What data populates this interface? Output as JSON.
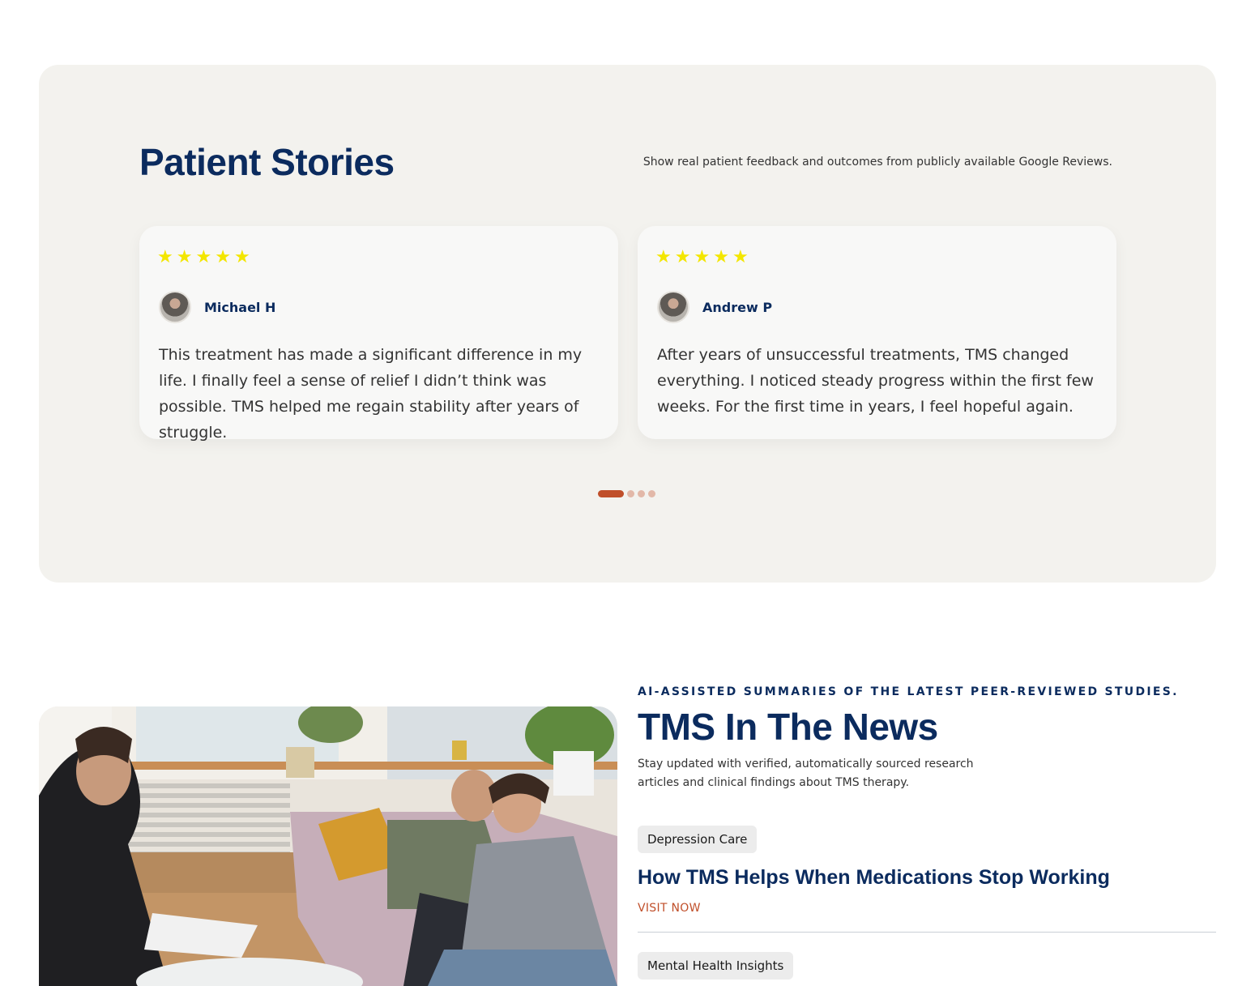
{
  "patient_stories": {
    "title": "Patient Stories",
    "description": "Show real patient feedback and outcomes from publicly available Google Reviews.",
    "reviews": [
      {
        "rating": 5,
        "name": "Michael H",
        "text": "This treatment has made a significant difference in my life. I finally feel a sense of relief I didn’t think was possible. TMS helped me regain stability after years of struggle."
      },
      {
        "rating": 5,
        "name": "Andrew P",
        "text": "After years of unsuccessful treatments, TMS changed everything. I noticed steady progress within the first few weeks. For the first time in years, I feel hopeful again."
      }
    ],
    "carousel": {
      "pages": 4,
      "active_page": 1
    },
    "colors": {
      "star": "#f3e600",
      "accent": "#c04f2a",
      "heading": "#0b2b5e",
      "panel": "#f3f2ee"
    }
  },
  "news": {
    "eyebrow": "AI-ASSISTED SUMMARIES OF THE LATEST PEER-REVIEWED STUDIES.",
    "title": "TMS In The News",
    "description": "Stay updated with verified, automatically sourced research articles and clinical findings about TMS therapy.",
    "articles": [
      {
        "tag": "Depression Care",
        "title": "How TMS Helps When Medications Stop Working",
        "link_label": "VISIT NOW"
      },
      {
        "tag": "Mental Health Insights"
      }
    ]
  }
}
